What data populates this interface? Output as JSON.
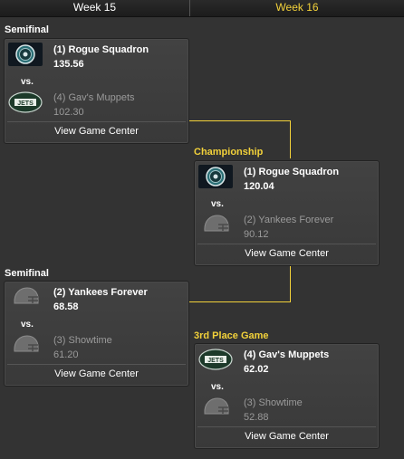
{
  "header": {
    "week15": "Week 15",
    "week16": "Week 16"
  },
  "rounds": {
    "semifinal_1": "Semifinal",
    "semifinal_2": "Semifinal",
    "championship": "Championship",
    "third_place": "3rd Place Game"
  },
  "matches": {
    "semi1": {
      "top": {
        "seed_name": "(1) Rogue Squadron",
        "score": "135.56",
        "logo": "rogue-squadron-logo"
      },
      "vs": "vs.",
      "bottom": {
        "seed_name": "(4) Gav's Muppets",
        "score": "102.30",
        "logo": "jets-logo"
      },
      "link": "View Game Center"
    },
    "semi2": {
      "top": {
        "seed_name": "(2) Yankees Forever",
        "score": "68.58",
        "logo": "helmet-icon"
      },
      "vs": "vs.",
      "bottom": {
        "seed_name": "(3) Showtime",
        "score": "61.20",
        "logo": "helmet-icon"
      },
      "link": "View Game Center"
    },
    "championship": {
      "top": {
        "seed_name": "(1) Rogue Squadron",
        "score": "120.04",
        "logo": "rogue-squadron-logo"
      },
      "vs": "vs.",
      "bottom": {
        "seed_name": "(2) Yankees Forever",
        "score": "90.12",
        "logo": "helmet-icon"
      },
      "link": "View Game Center"
    },
    "third_place": {
      "top": {
        "seed_name": "(4) Gav's Muppets",
        "score": "62.02",
        "logo": "jets-logo"
      },
      "vs": "vs.",
      "bottom": {
        "seed_name": "(3) Showtime",
        "score": "52.88",
        "logo": "helmet-icon"
      },
      "link": "View Game Center"
    }
  },
  "colors": {
    "background": "#333333",
    "accent": "#f2d13a",
    "card": "#3e3e3e",
    "muted_text": "#9a9a9a"
  }
}
